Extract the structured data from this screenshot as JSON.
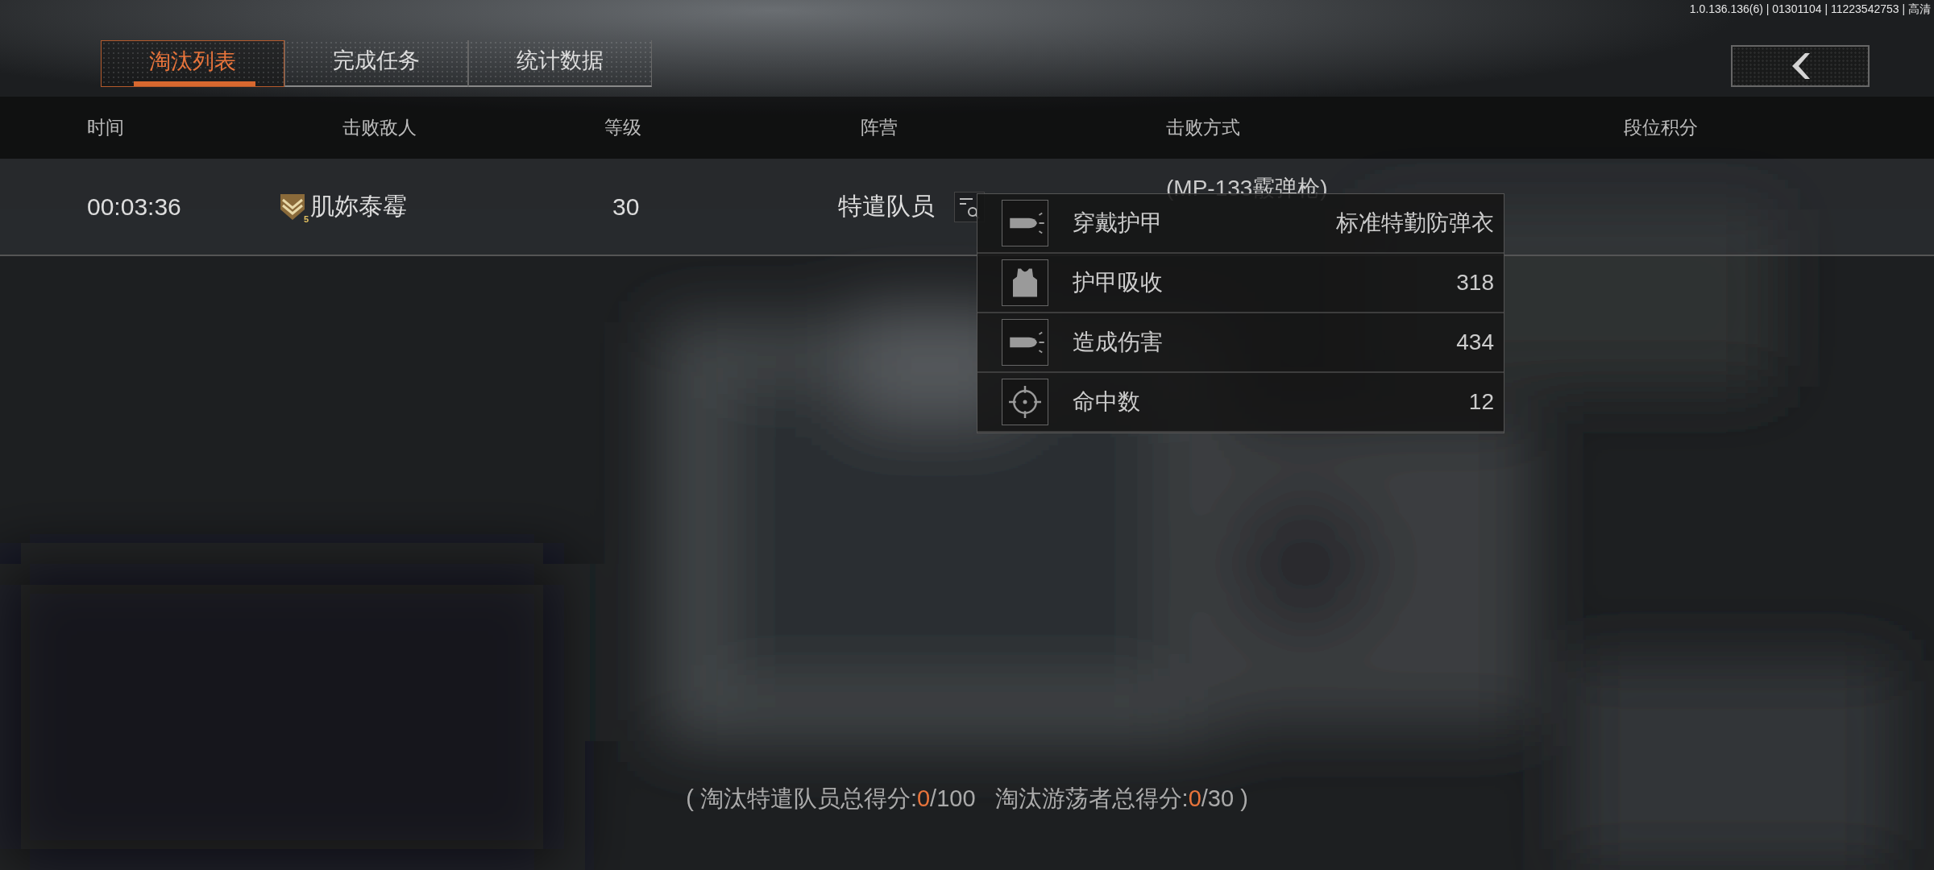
{
  "version_info": "1.0.136.136(6) | 01301104 | 11223542753 | 高清",
  "tabs": [
    {
      "label": "淘汰列表",
      "selected": true
    },
    {
      "label": "完成任务",
      "selected": false
    },
    {
      "label": "统计数据",
      "selected": false
    }
  ],
  "table": {
    "columns": [
      "时间",
      "击败敌人",
      "等级",
      "阵营",
      "击败方式",
      "段位积分"
    ],
    "rows": [
      {
        "time": "00:03:36",
        "rank_badge": "5",
        "enemy": "肌妳泰霉",
        "level": "30",
        "faction": "特遣队员",
        "kill_method": [
          "(MP-133霰弹枪)"
        ]
      }
    ]
  },
  "tooltip": {
    "rows": [
      {
        "kind": "bullet",
        "label": "穿戴护甲",
        "value": "标准特勤防弹衣"
      },
      {
        "kind": "vest",
        "label": "护甲吸收",
        "value": "318"
      },
      {
        "kind": "bullet",
        "label": "造成伤害",
        "value": "434"
      },
      {
        "kind": "target",
        "label": "命中数",
        "value": "12"
      }
    ]
  },
  "score_summary": {
    "open": "(",
    "items": [
      {
        "label": "淘汰特遣队员总得分:",
        "score": "0",
        "max": "/100"
      },
      {
        "label": "淘汰游荡者总得分:",
        "score": "0",
        "max": "/30"
      }
    ],
    "close": ")"
  }
}
